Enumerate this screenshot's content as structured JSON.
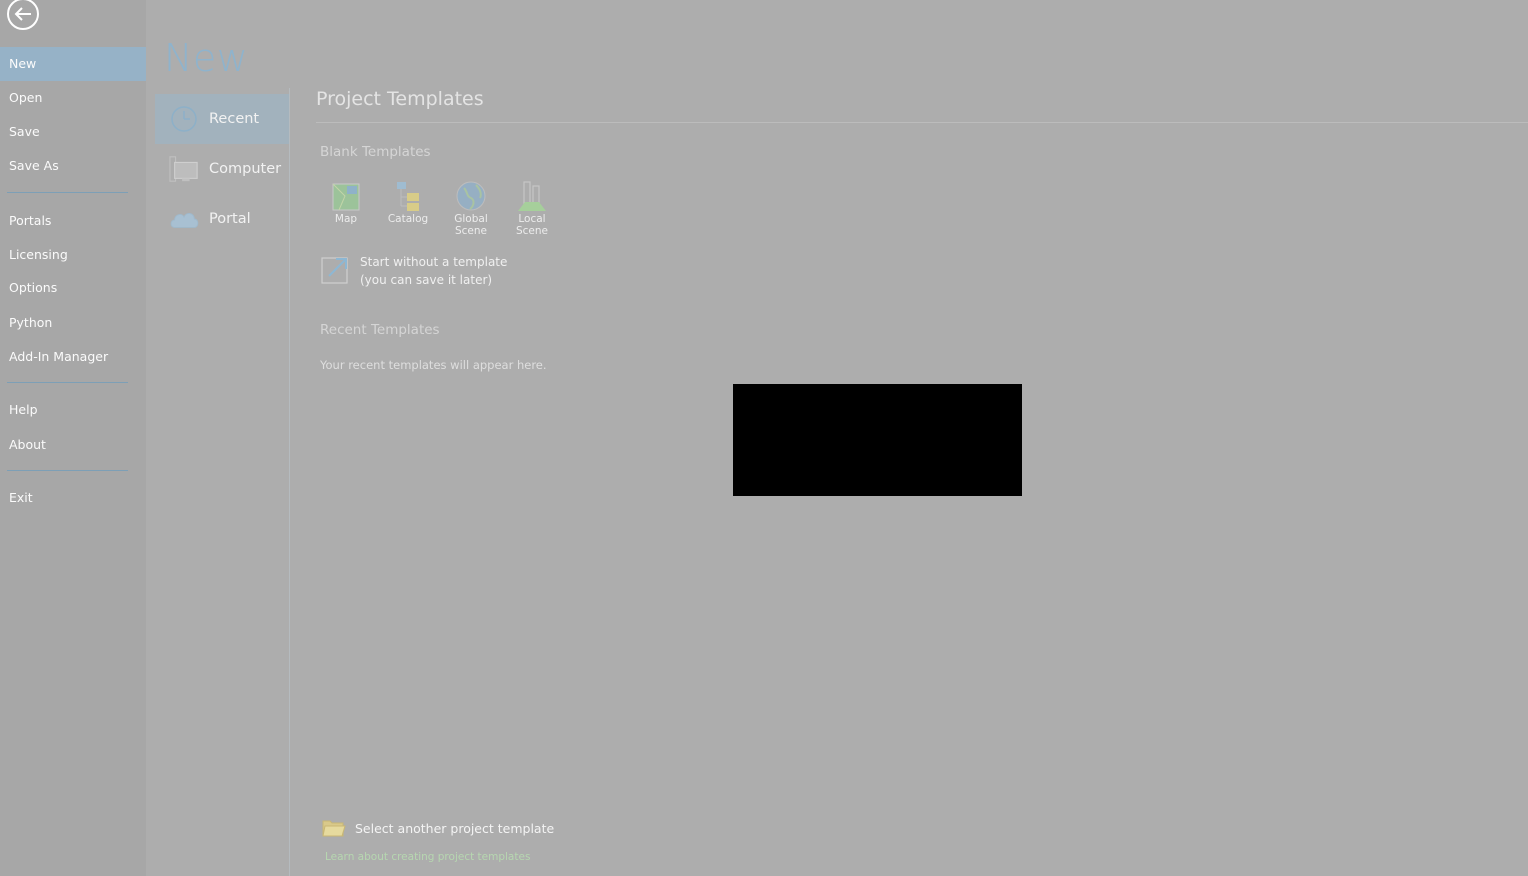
{
  "nav": {
    "items": [
      {
        "label": "New",
        "active": true
      },
      {
        "label": "Open"
      },
      {
        "label": "Save"
      },
      {
        "label": "Save As"
      },
      {
        "label": "Portals"
      },
      {
        "label": "Licensing"
      },
      {
        "label": "Options"
      },
      {
        "label": "Python"
      },
      {
        "label": "Add-In Manager"
      },
      {
        "label": "Help"
      },
      {
        "label": "About"
      },
      {
        "label": "Exit"
      }
    ]
  },
  "page": {
    "title": "New"
  },
  "subnav": {
    "items": [
      {
        "label": "Recent",
        "icon": "clock-icon",
        "active": true
      },
      {
        "label": "Computer",
        "icon": "computer-icon"
      },
      {
        "label": "Portal",
        "icon": "cloud-icon"
      }
    ]
  },
  "main": {
    "title": "Project Templates",
    "blank_heading": "Blank Templates",
    "templates": [
      {
        "label": "Map",
        "icon": "map-icon"
      },
      {
        "label": "Catalog",
        "icon": "catalog-icon"
      },
      {
        "label": "Global\nScene",
        "icon": "globe-icon"
      },
      {
        "label": "Local\nScene",
        "icon": "local-scene-icon"
      }
    ],
    "start_blank_line1": "Start without a template",
    "start_blank_line2": "(you can save it later)",
    "recent_heading": "Recent Templates",
    "recent_note": "Your recent templates will appear here.",
    "select_other": "Select another project template",
    "learn_link": "Learn about creating project templates"
  },
  "colors": {
    "accent": "#8fb3cc",
    "active_nav": "#96b2c7",
    "background": "#adadad",
    "link": "#b6d7b0"
  }
}
